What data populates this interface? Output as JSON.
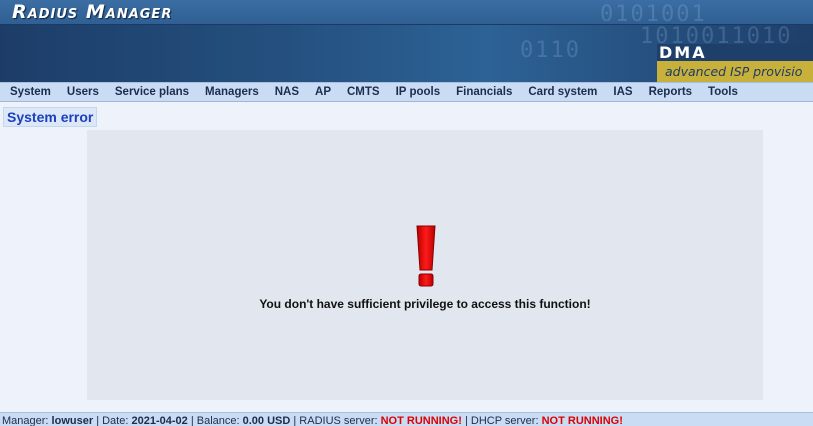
{
  "app": {
    "title": "Radius Manager",
    "logo_text": "DMA",
    "tagline": "advanced ISP provisio"
  },
  "nav": {
    "items": [
      "System",
      "Users",
      "Service plans",
      "Managers",
      "NAS",
      "AP",
      "CMTS",
      "IP pools",
      "Financials",
      "Card system",
      "IAS",
      "Reports",
      "Tools"
    ]
  },
  "page": {
    "section_title": "System error",
    "message": "You don't have sufficient privilege to access this function!",
    "icon": "exclamation-icon"
  },
  "footer": {
    "manager_label": "Manager:",
    "manager_value": "lowuser",
    "date_label": "Date:",
    "date_value": "2021-04-02",
    "balance_label": "Balance:",
    "balance_value": "0.00 USD",
    "radius_label": "RADIUS server:",
    "radius_value": "NOT RUNNING!",
    "dhcp_label": "DHCP server:",
    "dhcp_value": "NOT RUNNING!",
    "separator": "|"
  },
  "colors": {
    "header_blue": "#2a5286",
    "nav_bg": "#c9dcf3",
    "section_title": "#1a3fbf",
    "error_red": "#e00000",
    "tagline_gold": "#c7b13a"
  }
}
